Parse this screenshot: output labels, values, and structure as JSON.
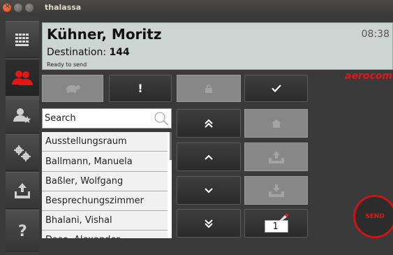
{
  "window": {
    "title": "thalassa"
  },
  "sidebar": {
    "items": [
      {
        "icon": "keypad-icon",
        "active": false
      },
      {
        "icon": "contacts-icon",
        "active": true
      },
      {
        "icon": "user-star-icon",
        "active": false
      },
      {
        "icon": "settings-gears-icon",
        "active": false
      },
      {
        "icon": "upload-tray-icon",
        "active": false
      },
      {
        "icon": "help-icon",
        "active": false
      }
    ]
  },
  "header": {
    "name": "Kühner, Moritz",
    "time": "08:38",
    "destination_label": "Destination:",
    "destination_value": "144",
    "status": "Ready to send"
  },
  "brand": "aerocom",
  "toolbar": {
    "priority_label": "!"
  },
  "search": {
    "placeholder": "Search"
  },
  "list": {
    "items": [
      "Ausstellungsraum",
      "Ballmann, Manuela",
      "Baßler, Wolfgang",
      "Besprechungszimmer",
      "Bhalani, Vishal",
      "Dase, Alexander"
    ]
  },
  "counter": {
    "value": "1"
  },
  "send": {
    "label": "SEND"
  },
  "colors": {
    "accent": "#d81b1b",
    "header_bg": "#ccd5d2",
    "panel_bg": "#3a3a3a"
  }
}
